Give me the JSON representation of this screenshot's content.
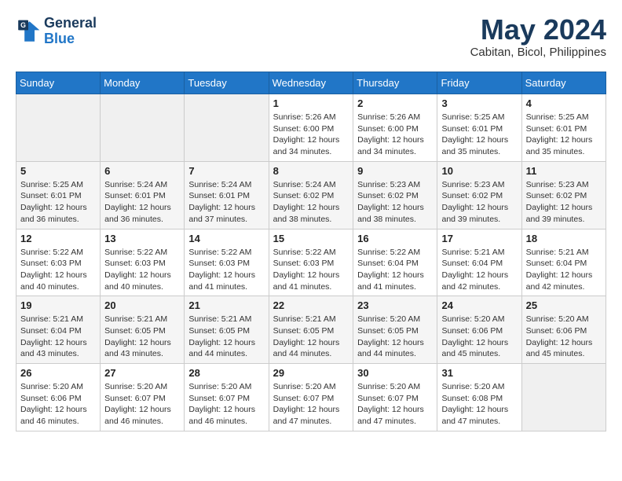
{
  "logo": {
    "line1": "General",
    "line2": "Blue"
  },
  "title": "May 2024",
  "subtitle": "Cabitan, Bicol, Philippines",
  "days_of_week": [
    "Sunday",
    "Monday",
    "Tuesday",
    "Wednesday",
    "Thursday",
    "Friday",
    "Saturday"
  ],
  "weeks": [
    [
      {
        "day": "",
        "info": ""
      },
      {
        "day": "",
        "info": ""
      },
      {
        "day": "",
        "info": ""
      },
      {
        "day": "1",
        "info": "Sunrise: 5:26 AM\nSunset: 6:00 PM\nDaylight: 12 hours\nand 34 minutes."
      },
      {
        "day": "2",
        "info": "Sunrise: 5:26 AM\nSunset: 6:00 PM\nDaylight: 12 hours\nand 34 minutes."
      },
      {
        "day": "3",
        "info": "Sunrise: 5:25 AM\nSunset: 6:01 PM\nDaylight: 12 hours\nand 35 minutes."
      },
      {
        "day": "4",
        "info": "Sunrise: 5:25 AM\nSunset: 6:01 PM\nDaylight: 12 hours\nand 35 minutes."
      }
    ],
    [
      {
        "day": "5",
        "info": "Sunrise: 5:25 AM\nSunset: 6:01 PM\nDaylight: 12 hours\nand 36 minutes."
      },
      {
        "day": "6",
        "info": "Sunrise: 5:24 AM\nSunset: 6:01 PM\nDaylight: 12 hours\nand 36 minutes."
      },
      {
        "day": "7",
        "info": "Sunrise: 5:24 AM\nSunset: 6:01 PM\nDaylight: 12 hours\nand 37 minutes."
      },
      {
        "day": "8",
        "info": "Sunrise: 5:24 AM\nSunset: 6:02 PM\nDaylight: 12 hours\nand 38 minutes."
      },
      {
        "day": "9",
        "info": "Sunrise: 5:23 AM\nSunset: 6:02 PM\nDaylight: 12 hours\nand 38 minutes."
      },
      {
        "day": "10",
        "info": "Sunrise: 5:23 AM\nSunset: 6:02 PM\nDaylight: 12 hours\nand 39 minutes."
      },
      {
        "day": "11",
        "info": "Sunrise: 5:23 AM\nSunset: 6:02 PM\nDaylight: 12 hours\nand 39 minutes."
      }
    ],
    [
      {
        "day": "12",
        "info": "Sunrise: 5:22 AM\nSunset: 6:03 PM\nDaylight: 12 hours\nand 40 minutes."
      },
      {
        "day": "13",
        "info": "Sunrise: 5:22 AM\nSunset: 6:03 PM\nDaylight: 12 hours\nand 40 minutes."
      },
      {
        "day": "14",
        "info": "Sunrise: 5:22 AM\nSunset: 6:03 PM\nDaylight: 12 hours\nand 41 minutes."
      },
      {
        "day": "15",
        "info": "Sunrise: 5:22 AM\nSunset: 6:03 PM\nDaylight: 12 hours\nand 41 minutes."
      },
      {
        "day": "16",
        "info": "Sunrise: 5:22 AM\nSunset: 6:04 PM\nDaylight: 12 hours\nand 41 minutes."
      },
      {
        "day": "17",
        "info": "Sunrise: 5:21 AM\nSunset: 6:04 PM\nDaylight: 12 hours\nand 42 minutes."
      },
      {
        "day": "18",
        "info": "Sunrise: 5:21 AM\nSunset: 6:04 PM\nDaylight: 12 hours\nand 42 minutes."
      }
    ],
    [
      {
        "day": "19",
        "info": "Sunrise: 5:21 AM\nSunset: 6:04 PM\nDaylight: 12 hours\nand 43 minutes."
      },
      {
        "day": "20",
        "info": "Sunrise: 5:21 AM\nSunset: 6:05 PM\nDaylight: 12 hours\nand 43 minutes."
      },
      {
        "day": "21",
        "info": "Sunrise: 5:21 AM\nSunset: 6:05 PM\nDaylight: 12 hours\nand 44 minutes."
      },
      {
        "day": "22",
        "info": "Sunrise: 5:21 AM\nSunset: 6:05 PM\nDaylight: 12 hours\nand 44 minutes."
      },
      {
        "day": "23",
        "info": "Sunrise: 5:20 AM\nSunset: 6:05 PM\nDaylight: 12 hours\nand 44 minutes."
      },
      {
        "day": "24",
        "info": "Sunrise: 5:20 AM\nSunset: 6:06 PM\nDaylight: 12 hours\nand 45 minutes."
      },
      {
        "day": "25",
        "info": "Sunrise: 5:20 AM\nSunset: 6:06 PM\nDaylight: 12 hours\nand 45 minutes."
      }
    ],
    [
      {
        "day": "26",
        "info": "Sunrise: 5:20 AM\nSunset: 6:06 PM\nDaylight: 12 hours\nand 46 minutes."
      },
      {
        "day": "27",
        "info": "Sunrise: 5:20 AM\nSunset: 6:07 PM\nDaylight: 12 hours\nand 46 minutes."
      },
      {
        "day": "28",
        "info": "Sunrise: 5:20 AM\nSunset: 6:07 PM\nDaylight: 12 hours\nand 46 minutes."
      },
      {
        "day": "29",
        "info": "Sunrise: 5:20 AM\nSunset: 6:07 PM\nDaylight: 12 hours\nand 47 minutes."
      },
      {
        "day": "30",
        "info": "Sunrise: 5:20 AM\nSunset: 6:07 PM\nDaylight: 12 hours\nand 47 minutes."
      },
      {
        "day": "31",
        "info": "Sunrise: 5:20 AM\nSunset: 6:08 PM\nDaylight: 12 hours\nand 47 minutes."
      },
      {
        "day": "",
        "info": ""
      }
    ]
  ]
}
